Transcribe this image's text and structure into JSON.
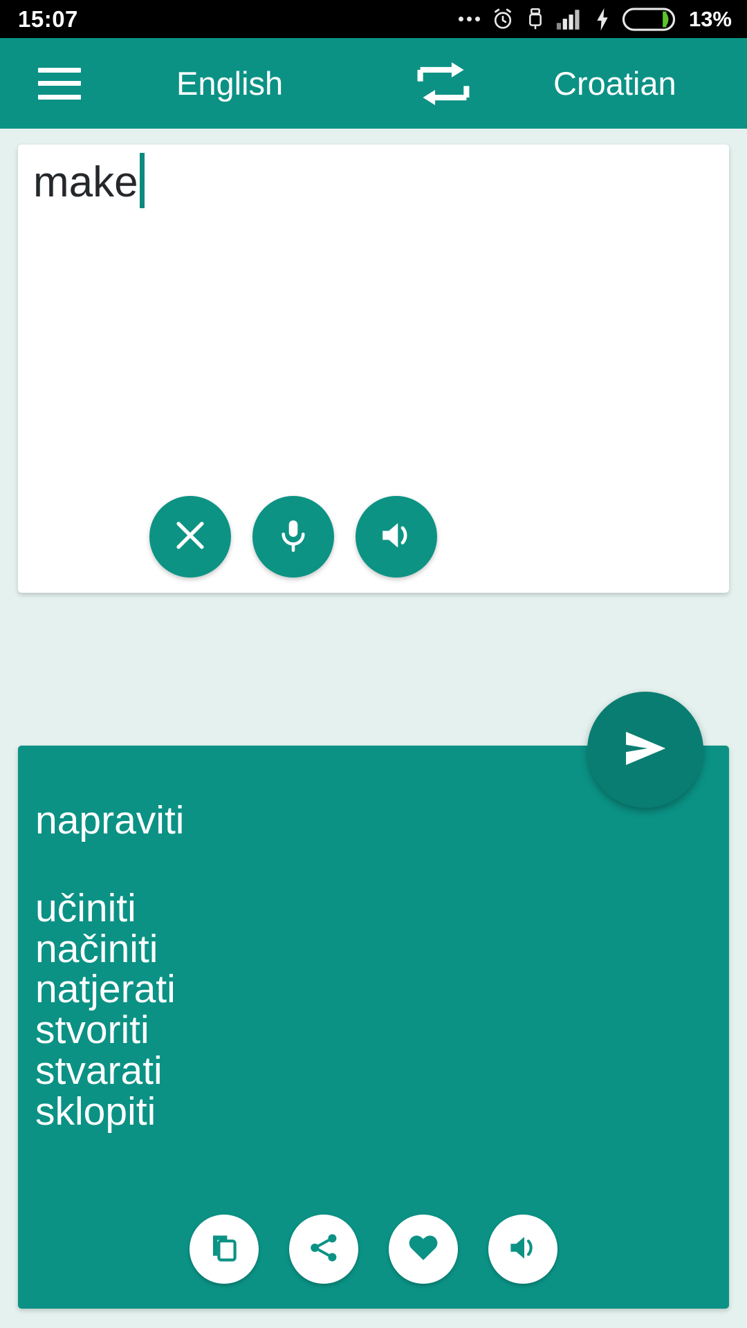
{
  "statusbar": {
    "time": "15:07",
    "battery_percent": "13%",
    "icons": [
      "more-dots-icon",
      "alarm-icon",
      "usb-icon",
      "signal-icon",
      "charging-bolt-icon",
      "battery-icon"
    ]
  },
  "appbar": {
    "menu_icon": "hamburger-menu-icon",
    "source_language": "English",
    "swap_icon": "swap-languages-icon",
    "target_language": "Croatian",
    "background": "#0b9285"
  },
  "source": {
    "text": "make",
    "placeholder": "",
    "actions": [
      {
        "name": "clear-button",
        "icon": "close-icon"
      },
      {
        "name": "voice-input-button",
        "icon": "microphone-icon"
      },
      {
        "name": "speak-source-button",
        "icon": "speaker-icon"
      }
    ]
  },
  "send": {
    "name": "translate-send-button",
    "icon": "send-icon",
    "color": "#0a7d72"
  },
  "result": {
    "primary": "napraviti",
    "alternatives": [
      "učiniti",
      "načiniti",
      "natjerati",
      "stvoriti",
      "stvarati",
      "sklopiti"
    ],
    "actions": [
      {
        "name": "copy-button",
        "icon": "copy-icon"
      },
      {
        "name": "share-button",
        "icon": "share-icon"
      },
      {
        "name": "favorite-button",
        "icon": "heart-icon"
      },
      {
        "name": "speak-result-button",
        "icon": "speaker-icon"
      }
    ]
  },
  "colors": {
    "accent": "#0b9285",
    "accent_dark": "#0a7d72",
    "page_bg": "#e4f1ee",
    "battery_green": "#5ec42c"
  }
}
